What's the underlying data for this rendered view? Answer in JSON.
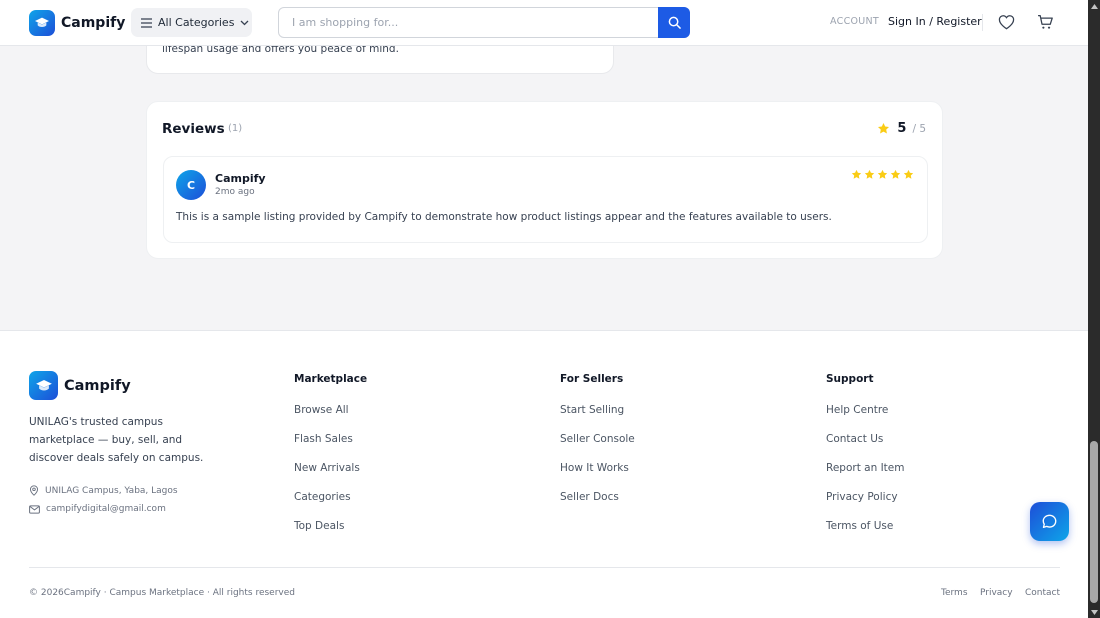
{
  "header": {
    "brand": "Campify",
    "categories_label": "All Categories",
    "search_placeholder": "I am shopping for...",
    "account_label": "ACCOUNT",
    "signin_label": "Sign In / Register"
  },
  "description": {
    "text_fragment": "lifespan usage and offers you peace of mind."
  },
  "reviews": {
    "title": "Reviews",
    "count": "(1)",
    "score": "5",
    "score_max": "/ 5",
    "items": [
      {
        "avatar_initial": "C",
        "name": "Campify",
        "time": "2mo ago",
        "rating": 5,
        "body": "This is a sample listing provided by Campify to demonstrate how product listings appear and the features available to users."
      }
    ]
  },
  "footer": {
    "brand": "Campify",
    "tagline": "UNILAG's trusted campus marketplace — buy, sell, and discover deals safely on campus.",
    "location": "UNILAG Campus, Yaba, Lagos",
    "email": "campifydigital@gmail.com",
    "columns": [
      {
        "heading": "Marketplace",
        "links": [
          "Browse All",
          "Flash Sales",
          "New Arrivals",
          "Categories",
          "Top Deals"
        ]
      },
      {
        "heading": "For Sellers",
        "links": [
          "Start Selling",
          "Seller Console",
          "How It Works",
          "Seller Docs"
        ]
      },
      {
        "heading": "Support",
        "links": [
          "Help Centre",
          "Contact Us",
          "Report an Item",
          "Privacy Policy",
          "Terms of Use"
        ]
      }
    ],
    "copyright": "© 2026Campify · Campus Marketplace · All rights reserved",
    "bottom_links": [
      "Terms",
      "Privacy",
      "Contact"
    ]
  },
  "colors": {
    "accent": "#1d5be5",
    "star": "#facc15",
    "page_bg": "#f4f4f6"
  },
  "icons": {
    "logo": "graduation-cap-icon",
    "categories": "menu-lines-icon",
    "search": "search-icon",
    "wishlist": "heart-icon",
    "cart": "cart-icon",
    "chat": "chat-bubble-icon"
  }
}
